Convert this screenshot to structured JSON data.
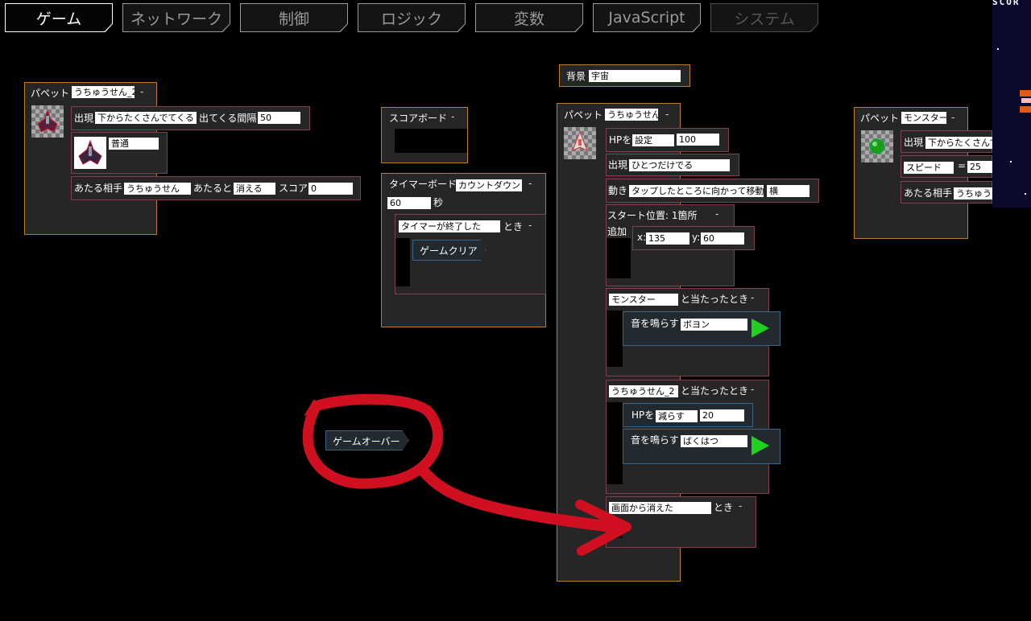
{
  "tabs": [
    {
      "label": "ゲーム",
      "state": "active"
    },
    {
      "label": "ネットワーク",
      "state": "normal"
    },
    {
      "label": "制御",
      "state": "normal"
    },
    {
      "label": "ロジック",
      "state": "normal"
    },
    {
      "label": "変数",
      "state": "normal"
    },
    {
      "label": "JavaScript",
      "state": "normal"
    },
    {
      "label": "システム",
      "state": "dim"
    }
  ],
  "puppet1": {
    "title": "パペット",
    "name": "うちゅうせん_2",
    "appear_label": "出現",
    "appear_value": "下からたくさんでてくる",
    "interval_label": "出てくる間隔",
    "interval_value": "50",
    "mode_value": "普通",
    "hit_label": "あたる相手",
    "hit_target": "うちゅうせん",
    "when_hit_label": "あたると",
    "when_hit_value": "消える",
    "score_label": "スコア",
    "score_value": "0"
  },
  "scoreboard": {
    "title": "スコアボード"
  },
  "timerboard": {
    "title": "タイマーボード",
    "mode": "カウントダウン",
    "seconds": "60",
    "sec_label": "秒",
    "event_value": "タイマーが終了した",
    "event_when": "とき",
    "action": "ゲームクリア"
  },
  "background": {
    "label": "背景",
    "value": "宇宙"
  },
  "puppet2": {
    "title": "パペット",
    "name": "うちゅうせん",
    "hp_label": "HPを",
    "hp_op": "設定",
    "hp_value": "100",
    "appear_label": "出現",
    "appear_value": "ひとつだけでる",
    "move_label": "動き",
    "move_value": "タップしたところに向かって移動",
    "move_dir": "横",
    "start_label": "スタート位置: 1箇所",
    "add_label": "追加",
    "x_label": "x:",
    "x_value": "135",
    "y_label": "y:",
    "y_value": "60",
    "ev1_target": "モンスター",
    "ev1_label": "と当たったとき",
    "sound_label": "音を鳴らす",
    "sound1": "ボヨン",
    "ev2_target": "うちゅうせん_2",
    "ev2_label": "と当たったとき",
    "hp2_label": "HPを",
    "hp2_op": "減らす",
    "hp2_value": "20",
    "sound2": "ばくはつ",
    "ev3_value": "画面から消えた",
    "ev3_when": "とき"
  },
  "puppet3": {
    "title": "パペット",
    "name": "モンスター",
    "appear_label": "出現",
    "appear_value": "下からたくさんで",
    "speed_label": "スピード",
    "speed_eq": "=",
    "speed_value": "25",
    "hit_label": "あたる相手",
    "hit_target": "うちゅう"
  },
  "loose_block": {
    "label": "ゲームオーバー"
  },
  "dash": "-",
  "preview": {
    "score_label": "SCOR"
  },
  "colors": {
    "annotation": "#d01020",
    "play": "#1fd21f",
    "block_border": "#c07a2c"
  }
}
